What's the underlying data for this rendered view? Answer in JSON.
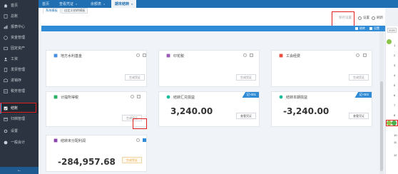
{
  "sidebar": {
    "items": [
      {
        "label": "首页",
        "icon": "home-icon"
      },
      {
        "label": "总账",
        "icon": "book-icon"
      },
      {
        "label": "报表中心",
        "icon": "report-icon"
      },
      {
        "label": "资金管理",
        "icon": "money-icon"
      },
      {
        "label": "固定资产",
        "icon": "asset-icon"
      },
      {
        "label": "工资",
        "icon": "salary-icon"
      },
      {
        "label": "发票管理",
        "icon": "invoice-icon"
      },
      {
        "label": "进销存",
        "icon": "inventory-icon"
      },
      {
        "label": "税务管理",
        "icon": "tax-icon"
      },
      {
        "label": "结账",
        "icon": "checkout-icon"
      },
      {
        "label": "归档管理",
        "icon": "archive-icon"
      },
      {
        "label": "设置",
        "icon": "gear-icon"
      },
      {
        "label": "一般会计",
        "icon": "accountant-icon"
      }
    ],
    "collapse_icon": "arrow-left-icon"
  },
  "tabs": [
    {
      "label": "首页"
    },
    {
      "label": "查看凭证"
    },
    {
      "label": "余额表"
    },
    {
      "label": "期末结转"
    }
  ],
  "subtabs": [
    {
      "label": "系统模板"
    },
    {
      "label": "自定义结转模板"
    }
  ],
  "toolbar": {
    "toolbar_disabled_label": "保存设置",
    "settings_label": "设置",
    "refresh_label": "刷新",
    "blue_btn1": "结转",
    "blue_btn2": "设置"
  },
  "cards": {
    "water": {
      "title": "地方水利基金",
      "btn": "生成凭证"
    },
    "stamp": {
      "title": "印花税",
      "btn": "生成凭证"
    },
    "union": {
      "title": "工会经费",
      "btn": "生成凭证"
    },
    "vat": {
      "title": "计提所得税",
      "btn": "生成凭证"
    },
    "exchange": {
      "title": "结转汇兑损益",
      "amount": "3,240.00",
      "btn": "查看凭证",
      "badge": "记-001"
    },
    "pl": {
      "title": "结转本期损益",
      "amount": "-3,240.00",
      "btn": "查看凭证",
      "badge": "记-002"
    },
    "undistributed": {
      "title": "结转未分配利润",
      "amount": "-284,957.68",
      "btn": "生成凭证"
    }
  },
  "calendar": {
    "year": "2020",
    "numbers": [
      "1",
      "2",
      "3",
      "4",
      "5",
      "6",
      "7",
      "8",
      "9",
      "10",
      "11",
      "12"
    ],
    "colors": {
      "accent": "#2f8bd6",
      "highlight": "#e02020",
      "active_month": "#8bc34a"
    }
  }
}
